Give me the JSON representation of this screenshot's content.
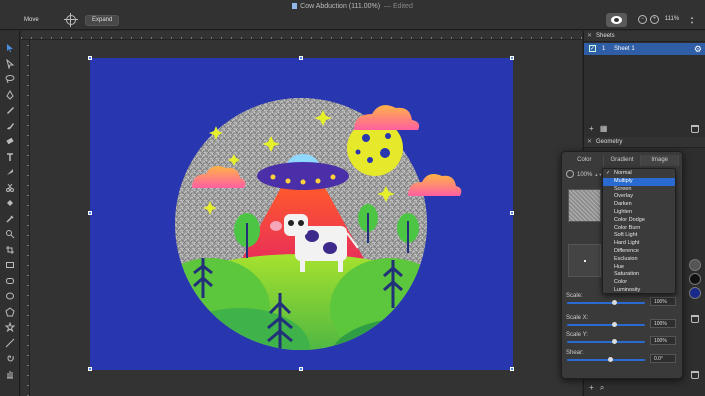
{
  "window": {
    "title": "Cow Abduction (111.00%)",
    "edited": "— Edited"
  },
  "toolbar": {
    "move_label": "Move",
    "expand_label": "Expand",
    "zoom": "111%"
  },
  "sheets": {
    "panel_title": "Sheets",
    "rows": [
      {
        "index": "1",
        "name": "Sheet 1"
      }
    ]
  },
  "geometry": {
    "panel_title": "Geometry"
  },
  "popover": {
    "tabs": [
      "Color",
      "Gradient",
      "Image"
    ],
    "opacity": "100%",
    "fields": [
      {
        "label": "Scale:",
        "value": "100%",
        "fraction": 0.6
      },
      {
        "label": "Scale X:",
        "value": "100%",
        "fraction": 0.6
      },
      {
        "label": "Scale Y:",
        "value": "100%",
        "fraction": 0.6
      },
      {
        "label": "Shear:",
        "value": "0.0°",
        "fraction": 0.55
      }
    ]
  },
  "blend_menu": {
    "selected": "Normal",
    "highlighted": "Multiply",
    "items": [
      "Normal",
      "Multiply",
      "Screen",
      "Overlay",
      "Darken",
      "Lighten",
      "Color Dodge",
      "Color Burn",
      "Soft Light",
      "Hard Light",
      "Difference",
      "Exclusion",
      "Hue",
      "Saturation",
      "Color",
      "Luminosity"
    ]
  },
  "colors": {
    "artboard": "#2836b0",
    "selection": "#2a6bd1",
    "accent": "#2f5ea6"
  },
  "tools": [
    "pointer-icon",
    "node-icon",
    "lasso-icon",
    "pen-icon",
    "pencil-icon",
    "brush-icon",
    "eraser-icon",
    "text-icon",
    "knife-icon",
    "scissors-icon",
    "fill-icon",
    "eyedropper-icon",
    "zoom-icon",
    "crop-icon",
    "rectangle-icon",
    "rounded-rect-icon",
    "ellipse-icon",
    "polygon-icon",
    "star-icon",
    "line-icon",
    "spiral-icon",
    "hand-icon"
  ]
}
